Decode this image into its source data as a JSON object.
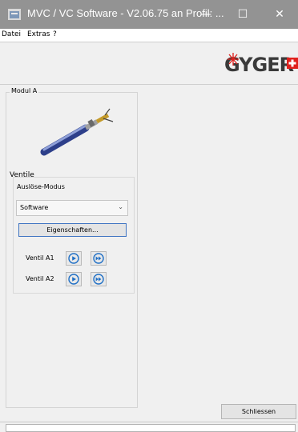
{
  "window": {
    "title": "MVC / VC Software - V2.06.75 an Profil: ...",
    "minimize_glyph": "—",
    "maximize_glyph": "☐",
    "close_glyph": "✕"
  },
  "menu": {
    "items": [
      "Datei",
      "Extras",
      "?"
    ]
  },
  "logo": {
    "text": "GYGER",
    "accent_color": "#e0201c"
  },
  "module": {
    "title": "Modul A",
    "image": "valve-image",
    "valves_section": {
      "title": "Ventile",
      "mode_label": "Auslöse-Modus",
      "mode_value": "Software",
      "properties_button": "Eigenschaften...",
      "valves": [
        {
          "label": "Ventil A1",
          "buttons": [
            "play-icon",
            "fast-forward-icon"
          ]
        },
        {
          "label": "Ventil A2",
          "buttons": [
            "play-icon",
            "fast-forward-icon"
          ]
        }
      ]
    }
  },
  "footer": {
    "close_button": "Schliessen"
  },
  "colors": {
    "titlebar": "#939393",
    "accent_blue": "#3f74c2",
    "icon_blue": "#1f6fc5"
  }
}
